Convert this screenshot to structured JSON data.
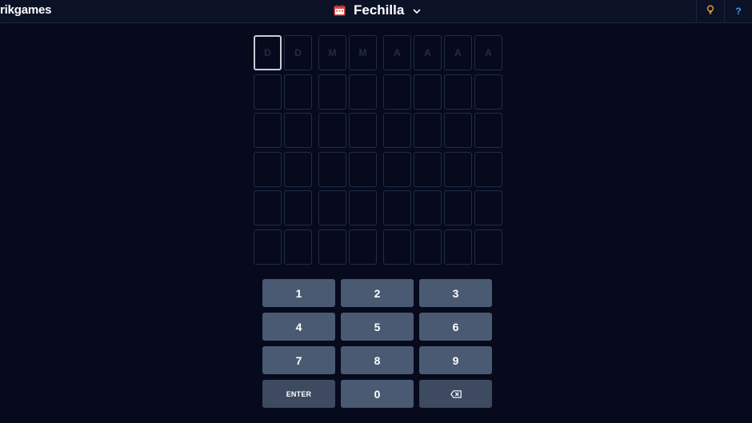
{
  "header": {
    "brand": "rikgames",
    "title": "Fechilla",
    "calendar_icon_color": "#e04646",
    "hint_icon_color": "#e8a33a",
    "help_icon_color": "#3aa0e8"
  },
  "board": {
    "placeholders": [
      "D",
      "D",
      "M",
      "M",
      "A",
      "A",
      "A",
      "A"
    ],
    "rows": 6,
    "active_cell": "1"
  },
  "keypad": {
    "keys": [
      "1",
      "2",
      "3",
      "4",
      "5",
      "6",
      "7",
      "8",
      "9",
      "ENTER",
      "0",
      "backspace"
    ],
    "enter_label": "ENTER"
  },
  "colors": {
    "background": "#060a1c",
    "key": "#4a5a72",
    "cell_border": "#1f2d47"
  }
}
